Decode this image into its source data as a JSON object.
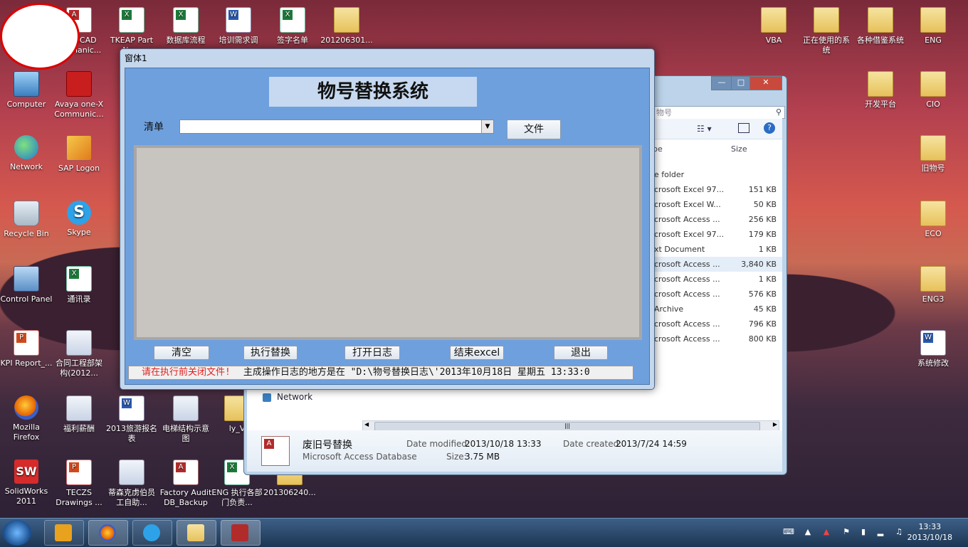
{
  "desktop": {
    "icons_left": [
      {
        "label": "AutoCAD Mechanic...",
        "kind": "acc"
      },
      {
        "label": "Computer",
        "kind": "pc"
      },
      {
        "label": "Avaya one-X Communic...",
        "kind": "avaya"
      },
      {
        "label": "Network",
        "kind": "globe"
      },
      {
        "label": "SAP Logon",
        "kind": "sap"
      },
      {
        "label": "Recycle Bin",
        "kind": "bin"
      },
      {
        "label": "Skype",
        "kind": "skype"
      },
      {
        "label": "Control Panel",
        "kind": "cp"
      },
      {
        "label": "通讯录",
        "kind": "xls"
      },
      {
        "label": "KPI Report_...",
        "kind": "ppt"
      },
      {
        "label": "合同工程部架构(2012...",
        "kind": "img"
      },
      {
        "label": "Mozilla Firefox",
        "kind": "ff"
      },
      {
        "label": "福利薪酬",
        "kind": "img"
      },
      {
        "label": "2013旅游报名表",
        "kind": "doc"
      },
      {
        "label": "电梯结构示意图",
        "kind": "img"
      },
      {
        "label": "ly_V",
        "kind": "folder"
      },
      {
        "label": "SolidWorks 2011",
        "kind": "sw"
      },
      {
        "label": "TECZS Drawings ...",
        "kind": "ppt"
      },
      {
        "label": "蒂森克虏伯员工自助...",
        "kind": "img"
      },
      {
        "label": "Factory Audit DB_Backup",
        "kind": "acc"
      },
      {
        "label": "ENG 执行各部门负责...",
        "kind": "xls"
      },
      {
        "label": "201306240...",
        "kind": "folder"
      }
    ],
    "icons_top": [
      {
        "label": "TKEAP Part Na...",
        "kind": "xls"
      },
      {
        "label": "数据库流程",
        "kind": "xls"
      },
      {
        "label": "培训需求调",
        "kind": "doc"
      },
      {
        "label": "签字名单",
        "kind": "xls"
      },
      {
        "label": "201206301...",
        "kind": "folder"
      }
    ],
    "icons_right": [
      {
        "label": "VBA",
        "kind": "folder"
      },
      {
        "label": "正在使用的系统",
        "kind": "folder"
      },
      {
        "label": "各种借鉴系统",
        "kind": "folder"
      },
      {
        "label": "ENG",
        "kind": "folder"
      },
      {
        "label": "开发平台",
        "kind": "folder"
      },
      {
        "label": "CIO",
        "kind": "folder"
      },
      {
        "label": "旧物号",
        "kind": "folder"
      },
      {
        "label": "ECO",
        "kind": "folder"
      },
      {
        "label": "ENG3",
        "kind": "folder"
      },
      {
        "label": "系统修改",
        "kind": "doc"
      }
    ]
  },
  "explorer": {
    "search_placeholder": "物号",
    "col_type": "pe",
    "col_size": "Size",
    "rows": [
      {
        "type": "e folder",
        "size": ""
      },
      {
        "type": "crosoft Excel 97...",
        "size": "151 KB"
      },
      {
        "type": "crosoft Excel W...",
        "size": "50 KB"
      },
      {
        "type": "crosoft Access ...",
        "size": "256 KB"
      },
      {
        "type": "crosoft Excel 97...",
        "size": "179 KB"
      },
      {
        "type": "xt Document",
        "size": "1 KB"
      },
      {
        "type": "crosoft Access ...",
        "size": "3,840 KB"
      },
      {
        "type": "crosoft Access ...",
        "size": "1 KB"
      },
      {
        "type": "crosoft Access ...",
        "size": "576 KB"
      },
      {
        "type": "Archive",
        "size": "45 KB"
      },
      {
        "type": "crosoft Access ...",
        "size": "796 KB"
      },
      {
        "type": "crosoft Access ...",
        "size": "800 KB"
      }
    ],
    "selected_row": 6,
    "nav_network": "Network",
    "details": {
      "name": "废旧号替换",
      "type": "Microsoft Access Database",
      "modified_label": "Date modified:",
      "modified": "2013/10/18 13:33",
      "size_label": "Size:",
      "size": "3.75 MB",
      "created_label": "Date created:",
      "created": "2013/7/24 14:59"
    }
  },
  "dialog": {
    "window_title": "窗体1",
    "heading": "物号替换系统",
    "list_label": "清单",
    "combo_value": "",
    "file_button": "文件",
    "buttons": {
      "clear": "清空",
      "execute": "执行替换",
      "open_log": "打开日志",
      "end_excel": "结束excel",
      "exit": "退出"
    },
    "status_warning": "请在执行前关闭文件!",
    "status_info": "主成操作日志的地方是在 \"D:\\物号替换日志\\'2013年10月18日 星期五 13:33:0"
  },
  "taskbar": {
    "time": "13:33",
    "date": "2013/10/18"
  },
  "colors": {
    "dialog_client": "#6fa0de",
    "heading_bg": "#c6d9f0",
    "status_warning": "#e02020"
  }
}
